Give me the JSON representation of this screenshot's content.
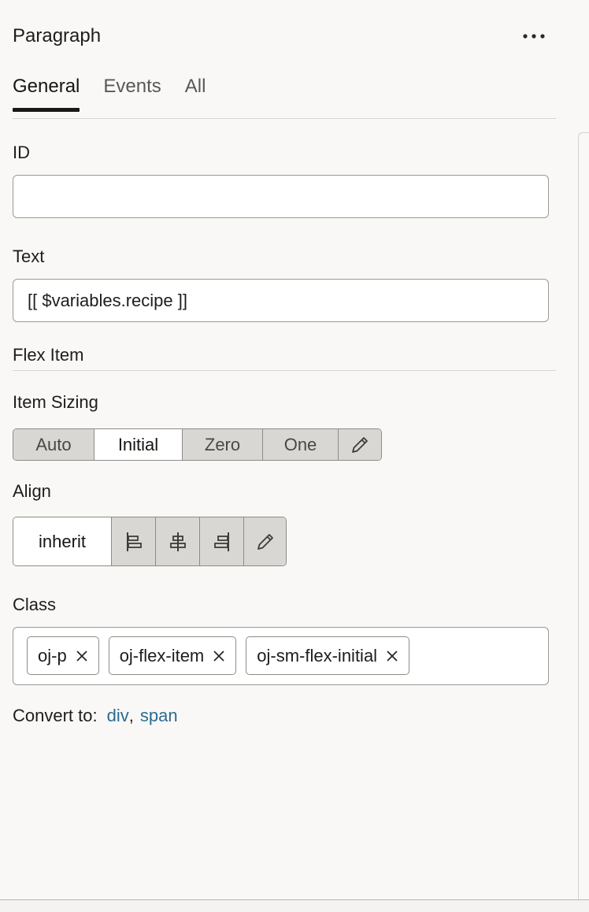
{
  "panel": {
    "title": "Paragraph",
    "more_icon": "more-horizontal-icon"
  },
  "tabs": [
    {
      "label": "General",
      "active": true
    },
    {
      "label": "Events",
      "active": false
    },
    {
      "label": "All",
      "active": false
    }
  ],
  "fields": {
    "id": {
      "label": "ID",
      "value": ""
    },
    "text": {
      "label": "Text",
      "value": "[[ $variables.recipe ]]"
    }
  },
  "flex_item": {
    "section_title": "Flex Item",
    "item_sizing": {
      "label": "Item Sizing",
      "options": [
        "Auto",
        "Initial",
        "Zero",
        "One"
      ],
      "selected": "Initial",
      "edit_icon": "pencil-icon"
    },
    "align": {
      "label": "Align",
      "selected_label": "inherit",
      "icons": [
        "align-start-icon",
        "align-center-icon",
        "align-end-icon",
        "pencil-icon"
      ]
    }
  },
  "class_field": {
    "label": "Class",
    "chips": [
      "oj-p",
      "oj-flex-item",
      "oj-sm-flex-initial"
    ],
    "remove_icon": "close-icon"
  },
  "convert": {
    "label": "Convert to:",
    "links": [
      "div",
      "span"
    ],
    "separator": ","
  },
  "colors": {
    "link": "#2b6b8f",
    "segment_bg": "#d9d7d4",
    "panel_bg": "#f9f8f6"
  }
}
